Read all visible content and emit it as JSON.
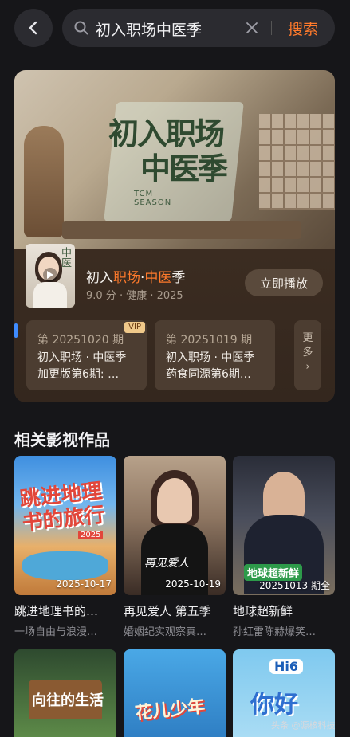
{
  "search": {
    "query": "初入职场中医季",
    "button_label": "搜索"
  },
  "hero": {
    "art_title_line1": "初入职场",
    "art_title_line2": "中医季",
    "art_tcm_line1": "TCM",
    "art_tcm_line2": "SEASON",
    "thumb_text": "中医",
    "title_part1": "初入",
    "title_hl1": "职场",
    "title_part2": "·",
    "title_hl2": "中医",
    "title_part3": "季",
    "meta": "9.0 分 · 健康 · 2025",
    "play_label": "立即播放",
    "episodes": [
      {
        "period": "第 20251020 期",
        "line1": "初入职场 · 中医季",
        "line2": "加更版第6期: …",
        "badge": "VIP"
      },
      {
        "period": "第 20251019 期",
        "line1": "初入职场 · 中医季",
        "line2": "药食同源第6期…",
        "badge": ""
      }
    ],
    "more_label_1": "更",
    "more_label_2": "多",
    "more_arrow": "›"
  },
  "related": {
    "title": "相关影视作品",
    "items": [
      {
        "art": "跳进地理书的旅行",
        "art_year": "2025",
        "date": "2025-10-17",
        "name": "跳进地理书的…",
        "desc": "一场自由与浪漫…"
      },
      {
        "art": "再见爱人",
        "date": "2025-10-19",
        "name": "再见爱人 第五季",
        "desc": "婚姻纪实观察真…"
      },
      {
        "art": "地球超新鲜",
        "date": "20251013 期全",
        "name": "地球超新鲜",
        "desc": "孙红雷陈赫爆笑…"
      }
    ],
    "row2": [
      {
        "art": "向往的生活"
      },
      {
        "art": "花儿少年"
      },
      {
        "art_badge": "Hi6",
        "art": "你好"
      }
    ]
  },
  "watermark": "头条 @源核科技"
}
